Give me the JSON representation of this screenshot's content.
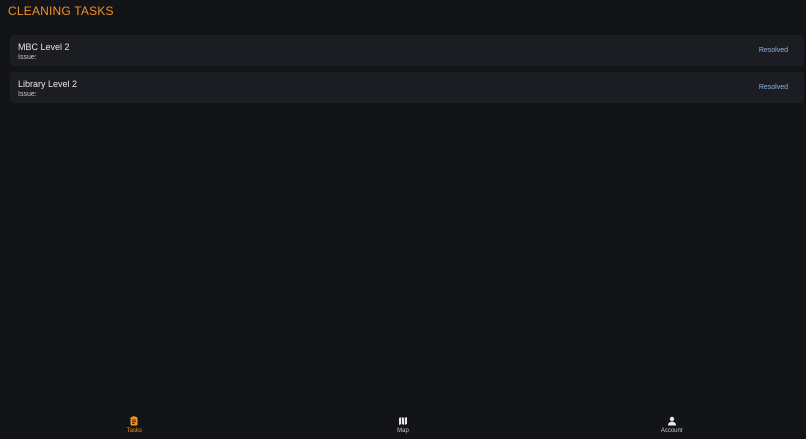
{
  "header": {
    "title": "CLEANING TASKS"
  },
  "tasks": [
    {
      "location": "MBC Level 2",
      "issue_label": "Issue:",
      "status": "Resolved"
    },
    {
      "location": "Library Level 2",
      "issue_label": "Issue:",
      "status": "Resolved"
    }
  ],
  "nav": {
    "items": [
      {
        "label": "Tasks",
        "icon": "clipboard-icon",
        "active": true
      },
      {
        "label": "Map",
        "icon": "map-icon",
        "active": false
      },
      {
        "label": "Account",
        "icon": "person-icon",
        "active": false
      }
    ]
  },
  "colors": {
    "accent": "#f0902a",
    "background": "#131418",
    "card": "#1c1d22",
    "status": "#8fb3e0"
  }
}
